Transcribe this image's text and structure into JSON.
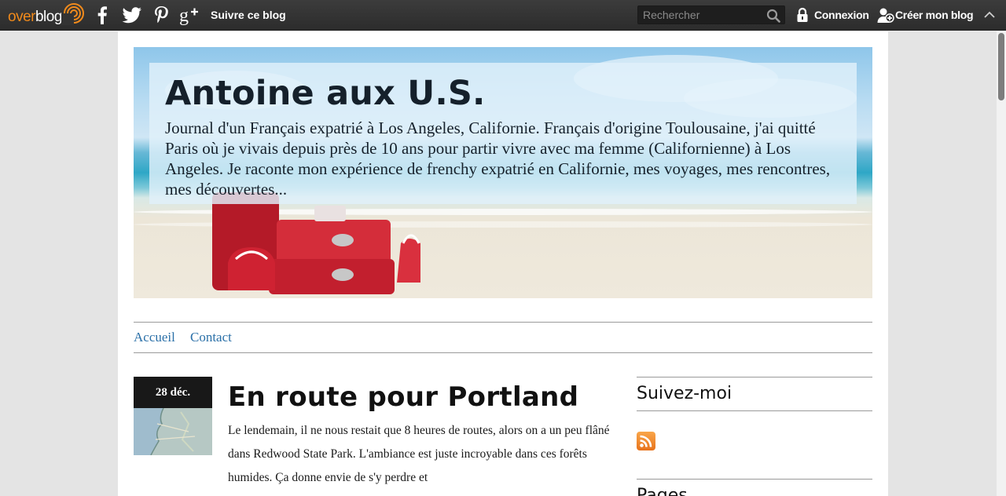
{
  "topbar": {
    "logo_over": "over",
    "logo_blog": "blog",
    "follow_label": "Suivre ce blog",
    "search_placeholder": "Rechercher",
    "login_label": "Connexion",
    "create_label": "Créer mon blog",
    "social_icons": [
      "facebook-icon",
      "twitter-icon",
      "pinterest-icon",
      "google-plus-icon"
    ]
  },
  "blog": {
    "title": "Antoine aux U.S.",
    "description": "Journal d'un Français expatrié à Los Angeles, Californie. Français d'origine Toulousaine, j'ai quitté Paris où je vivais depuis près de 10 ans pour partir vivre avec ma femme (Californienne) à Los Angeles. Je raconte mon expérience de frenchy expatrié en Californie, mes voyages, mes rencontres, mes découvertes..."
  },
  "nav": {
    "items": [
      "Accueil",
      "Contact"
    ]
  },
  "post": {
    "date": "28 déc.",
    "title": "En route pour Portland",
    "excerpt": "Le lendemain, il ne nous restait que 8 heures de routes, alors on a un peu flâné dans Redwood State Park. L'ambiance est juste incroyable dans ces forêts humides. Ça donne envie de s'y perdre et"
  },
  "sidebar": {
    "follow_title": "Suivez-moi",
    "pages_title": "Pages"
  },
  "colors": {
    "topbar": "#333333",
    "logo_orange": "#f08a1c",
    "link_blue": "#2b70a8",
    "rss_orange": "#f08a1c"
  }
}
